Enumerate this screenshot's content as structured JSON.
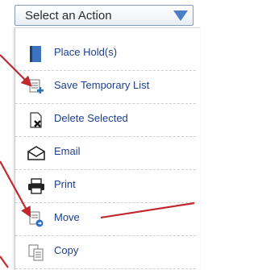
{
  "select": {
    "label": "Select an Action",
    "arrow_icon": "triangle-down-icon",
    "arrow_color": "#4d7fc7"
  },
  "menu": {
    "items": [
      {
        "label": "Place Hold(s)",
        "icon": "book-icon"
      },
      {
        "label": "Save Temporary List",
        "icon": "save-list-icon"
      },
      {
        "label": "Delete Selected",
        "icon": "delete-icon"
      },
      {
        "label": "Email",
        "icon": "email-icon"
      },
      {
        "label": "Print",
        "icon": "printer-icon"
      },
      {
        "label": "Move",
        "icon": "move-icon"
      },
      {
        "label": "Copy",
        "icon": "copy-icon"
      }
    ]
  },
  "colors": {
    "label_text": "#1c3f8f",
    "annotation_arrow": "#c0282e"
  }
}
